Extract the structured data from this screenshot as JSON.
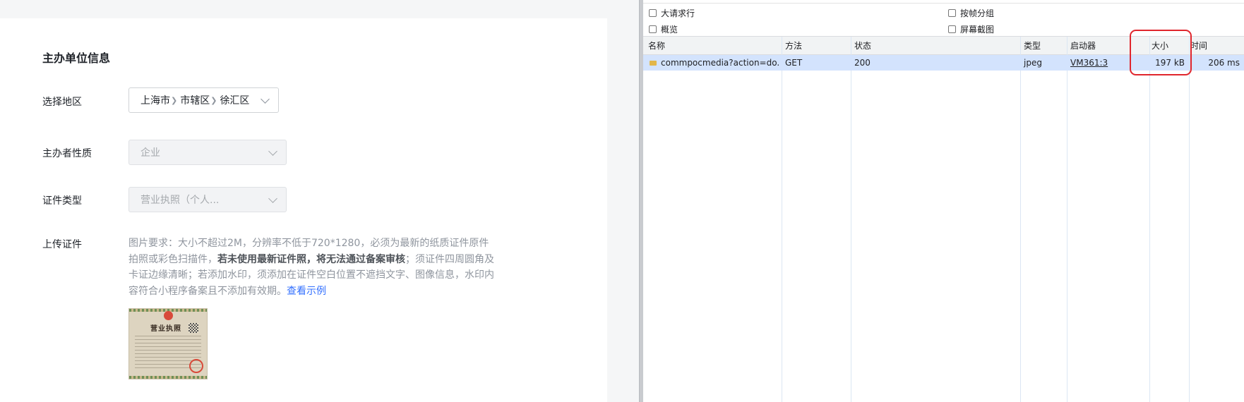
{
  "form": {
    "section_title": "主办单位信息",
    "region": {
      "label": "选择地区",
      "province": "上海市",
      "city": "市辖区",
      "district": "徐汇区"
    },
    "organizer_type": {
      "label": "主办者性质",
      "value": "企业"
    },
    "certificate_type": {
      "label": "证件类型",
      "value": "营业执照（个人..."
    },
    "upload": {
      "label": "上传证件",
      "requirement_part1": "图片要求：大小不超过2M，分辨率不低于720*1280，必须为最新的纸质证件原件拍照或彩色扫描件，",
      "requirement_bold": "若未使用最新证件照，将无法通过备案审核",
      "requirement_part2": "；须证件四周圆角及卡证边缘清晰；若添加水印，须添加在证件空白位置不遮挡文字、图像信息，水印内容符合小程序备案且不添加有效期。",
      "example_link": "查看示例",
      "thumbnail_title": "营业执照"
    }
  },
  "devtools": {
    "filters": {
      "large_rows": "大请求行",
      "group_by_frame": "按帧分组",
      "overview": "概览",
      "screenshots": "屏幕截图"
    },
    "columns": {
      "name": "名称",
      "method": "方法",
      "status": "状态",
      "type": "类型",
      "initiator": "启动器",
      "size": "大小",
      "time": "时间"
    },
    "rows": [
      {
        "name": "commpocmedia?action=do...",
        "method": "GET",
        "status": "200",
        "type": "jpeg",
        "initiator": "VM361:3",
        "size": "197 kB",
        "time": "206 ms"
      }
    ],
    "highlight_color": "#e0262d"
  }
}
